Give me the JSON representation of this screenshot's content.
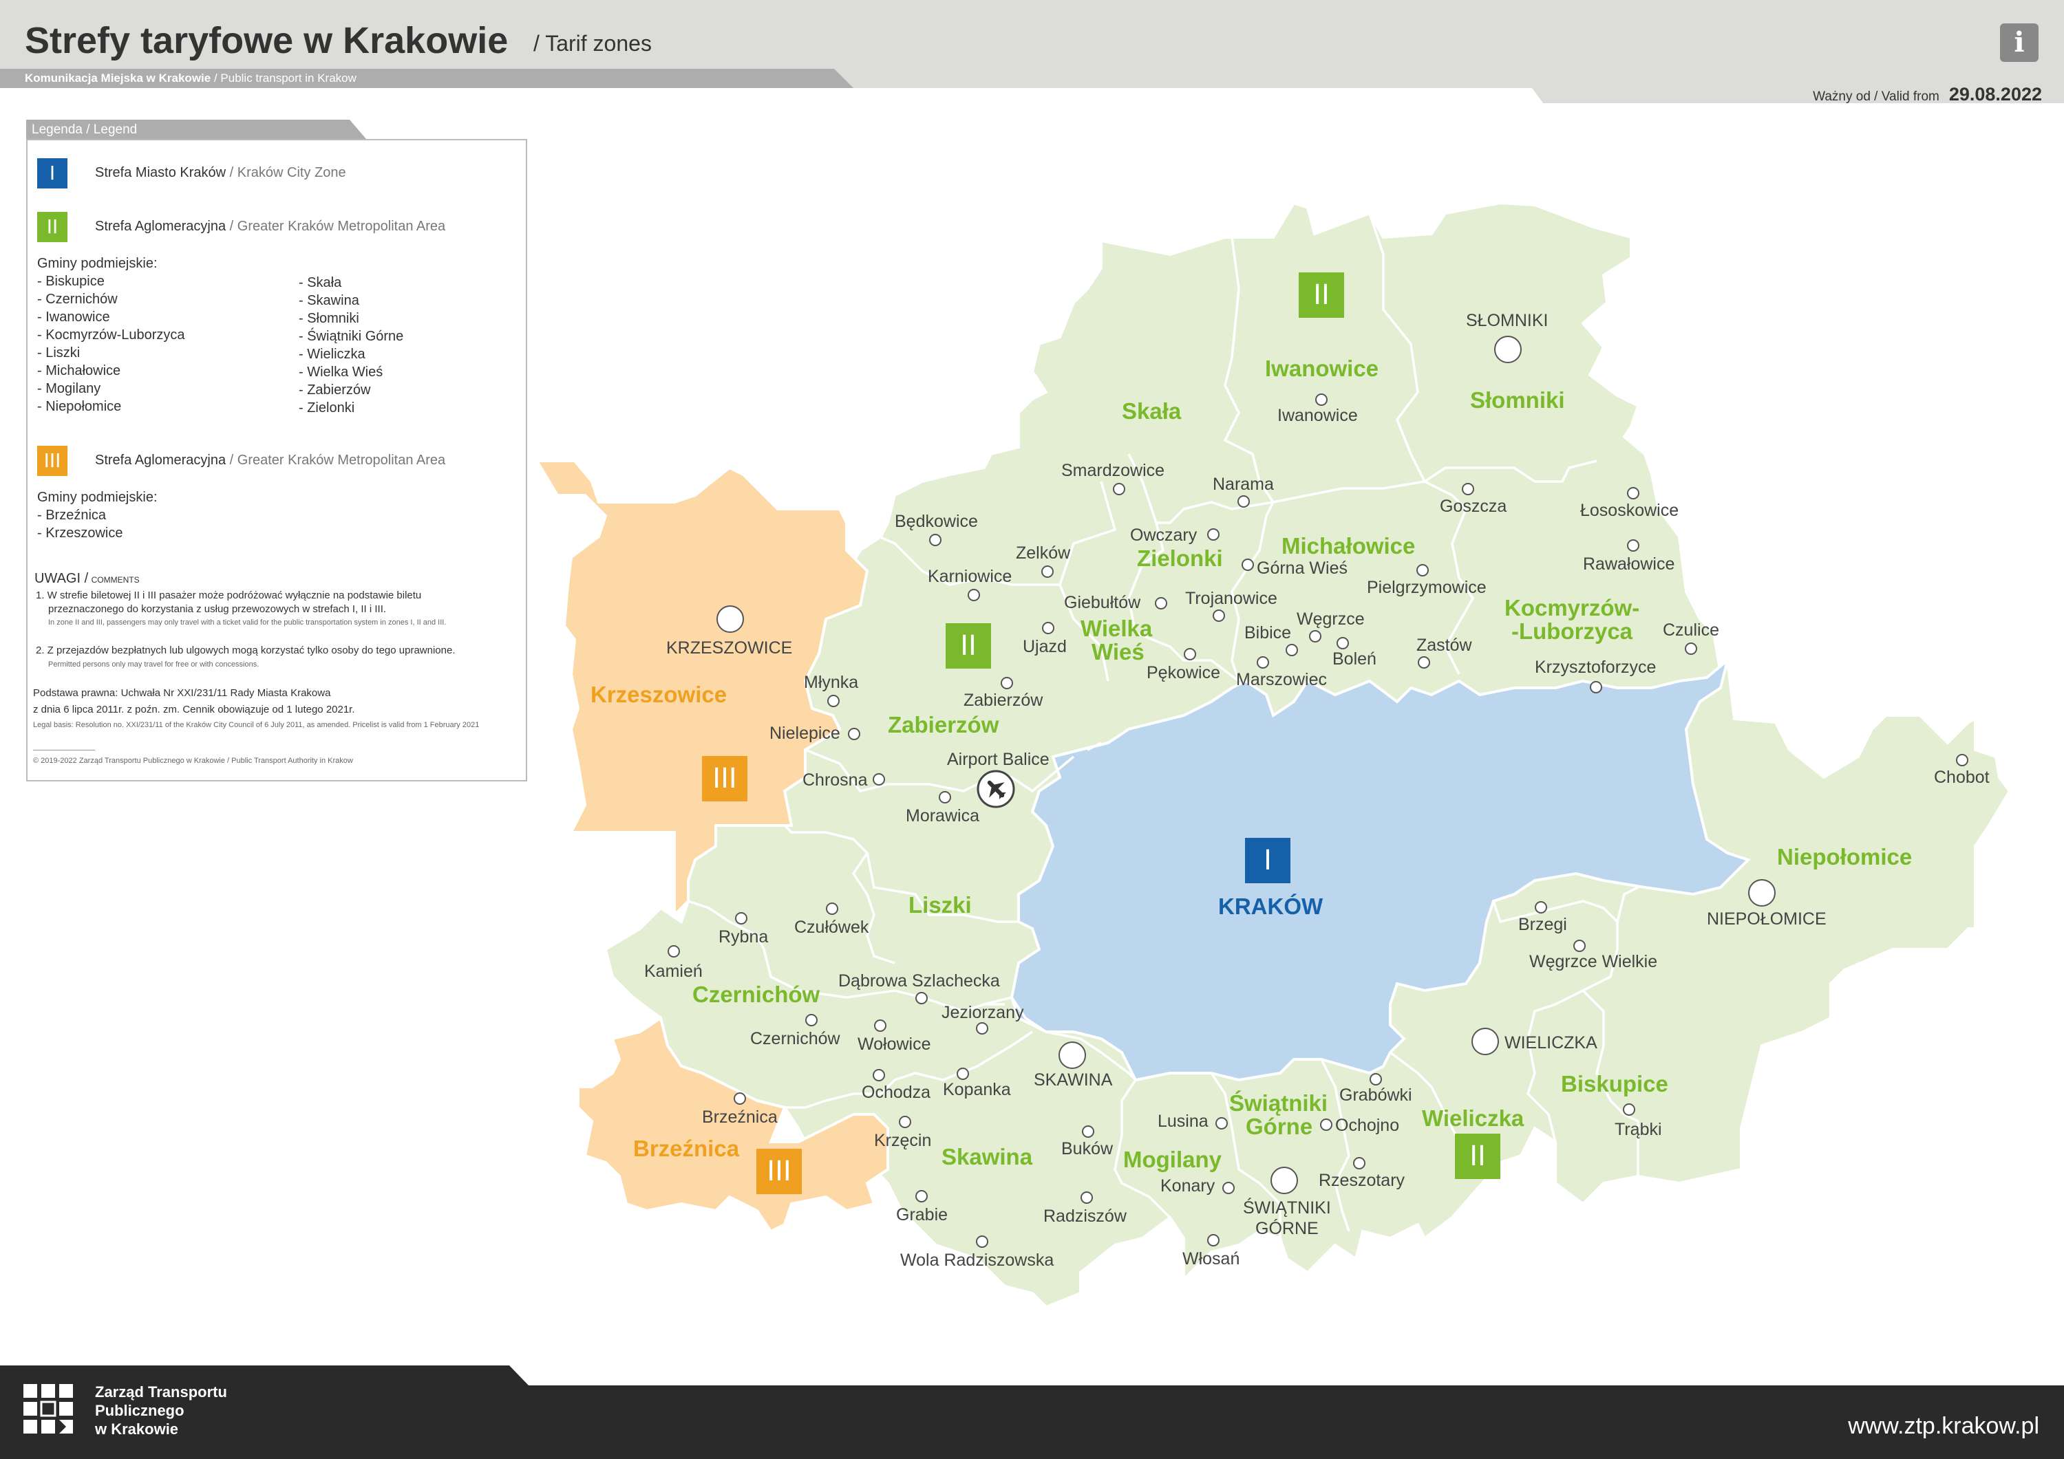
{
  "header": {
    "title": "Strefy taryfowe w Krakowie",
    "subtitle": "/ Tarif zones",
    "operator_pl": "Komunikacja Miejska w Krakowie",
    "operator_en": "/ Public transport in Krakow",
    "valid_label": "Ważny od  / Valid from",
    "valid_date": "29.08.2022",
    "info_icon": "i"
  },
  "colors": {
    "zone1": "#1560a8",
    "zone1_area": "#bcd6ee",
    "zone2": "#7ab82c",
    "zone2_area": "#e3eed2",
    "zone3": "#f0a020",
    "zone3_area": "#fcd9a6",
    "header_gray": "#dcddd8",
    "band_gray": "#adadad",
    "footer_dark": "#2a2a2a"
  },
  "legend": {
    "tab": "Legenda  / Legend",
    "zone1": {
      "numeral": "I",
      "pl": "Strefa Miasto Kraków",
      "en": "/ Kraków City Zone"
    },
    "zone2": {
      "numeral": "II",
      "pl": "Strefa Aglomeracyjna",
      "en": "/ Greater Kraków Metropolitan Area"
    },
    "zone2_gminy_header": "Gminy podmiejskie:",
    "zone2_gminy_col1": [
      "- Biskupice",
      "- Czernichów",
      "- Iwanowice",
      "- Kocmyrzów-Luborzyca",
      "- Liszki",
      "- Michałowice",
      "- Mogilany",
      "- Niepołomice"
    ],
    "zone2_gminy_col2": [
      "- Skała",
      "- Skawina",
      "- Słomniki",
      "- Świątniki Górne",
      "- Wieliczka",
      "- Wielka Wieś",
      "- Zabierzów",
      "- Zielonki"
    ],
    "zone3": {
      "numeral": "III",
      "pl": "Strefa Aglomeracyjna",
      "en": "/ Greater Kraków Metropolitan Area"
    },
    "zone3_gminy_header": "Gminy podmiejskie:",
    "zone3_gminy": [
      "- Brzeźnica",
      "- Krzeszowice"
    ],
    "notes_header": "UWAGI /",
    "notes_header_en": "COMMENTS",
    "note1_a": "1. W strefie biletowej II i III pasażer może podróżować wyłącznie na podstawie biletu",
    "note1_b": "przeznaczonego do korzystania z usług przewozowych w strefach I, II i III.",
    "note1_en": "In zone II and III, passengers may only travel with a ticket valid for the public transportation system in zones I, II and III.",
    "note2": "2. Z przejazdów bezpłatnych lub ulgowych mogą korzystać tylko osoby do tego uprawnione.",
    "note2_en": "Permitted persons only may travel for free or with concessions.",
    "legal_a": "Podstawa prawna: Uchwała Nr XXI/231/11 Rady Miasta Krakowa",
    "legal_b": "z dnia 6 lipca 2011r. z poźn. zm. Cennik obowiązuje od 1 lutego 2021r.",
    "legal_en": "Legal basis: Resolution no. XXI/231/11 of the Kraków City Council of 6 July 2011, as amended. Pricelist is valid from 1 February 2021",
    "copyright": "© 2019-2022 Zarząd Transportu Publicznego w Krakowie / Public Transport Authority in Krakow"
  },
  "map": {
    "gminy": [
      {
        "name": "Iwanowice",
        "color": "green"
      },
      {
        "name": "Słomniki",
        "color": "green"
      },
      {
        "name": "Skała",
        "color": "green"
      },
      {
        "name": "Michałowice",
        "color": "green"
      },
      {
        "name": "Zielonki",
        "color": "green"
      },
      {
        "name": "Wielka",
        "color": "green"
      },
      {
        "name": "Wieś",
        "color": "green"
      },
      {
        "name": "Kocmyrzów-",
        "color": "green"
      },
      {
        "name": "-Luborzyca",
        "color": "green"
      },
      {
        "name": "Krzeszowice",
        "color": "orange"
      },
      {
        "name": "Zabierzów",
        "color": "green"
      },
      {
        "name": "KRAKÓW",
        "color": "blue"
      },
      {
        "name": "Niepołomice",
        "color": "green"
      },
      {
        "name": "Liszki",
        "color": "green"
      },
      {
        "name": "Czernichów",
        "color": "green"
      },
      {
        "name": "Biskupice",
        "color": "green"
      },
      {
        "name": "Świątniki",
        "color": "green"
      },
      {
        "name": "Górne",
        "color": "green"
      },
      {
        "name": "Wieliczka",
        "color": "green"
      },
      {
        "name": "Brzeźnica",
        "color": "orange"
      },
      {
        "name": "Skawina",
        "color": "green"
      },
      {
        "name": "Mogilany",
        "color": "green"
      }
    ],
    "towns": [
      "SŁOMNIKI",
      "Iwanowice",
      "Smardzowice",
      "Narama",
      "Goszcza",
      "Łososkowice",
      "Będkowice",
      "Zelków",
      "Owczary",
      "Karniowice",
      "Górna Wieś",
      "Rawałowice",
      "Pielgrzymowice",
      "Giebułtów",
      "Trojanowice",
      "Węgrzce",
      "KRZESZOWICE",
      "Ujazd",
      "Bibice",
      "Zastów",
      "Czulice",
      "Boleń",
      "Pękowice",
      "Marszowiec",
      "Krzysztoforzyce",
      "Młynka",
      "Zabierzów",
      "Nielepice",
      "Airport Balice",
      "Chrosna",
      "Morawica",
      "Chobot",
      "NIEPOŁOMICE",
      "Brzegi",
      "Rybna",
      "Czułówek",
      "Węgrzce Wielkie",
      "Kamień",
      "Dąbrowa Szlachecka",
      "Jeziorzany",
      "Czernichów",
      "Wołowice",
      "WIELICZKA",
      "SKAWINA",
      "Ochodza",
      "Kopanka",
      "Grabówki",
      "Brzeźnica",
      "Lusina",
      "Ochojno",
      "Trąbki",
      "Krzęcin",
      "Buków",
      "Rzeszotary",
      "Konary",
      "ŚWIĄTNIKI",
      "GÓRNE",
      "Grabie",
      "Radziszów",
      "Włosań",
      "Wola Radziszowska"
    ],
    "zone_badges": [
      "II",
      "II",
      "III",
      "I",
      "III",
      "II"
    ],
    "airport_icon": "airplane-icon"
  },
  "footer": {
    "logo_icon": "ztp-logo-icon",
    "name": "Zarząd Transportu\nPublicznego\nw Krakowie",
    "url": "www.ztp.krakow.pl"
  }
}
